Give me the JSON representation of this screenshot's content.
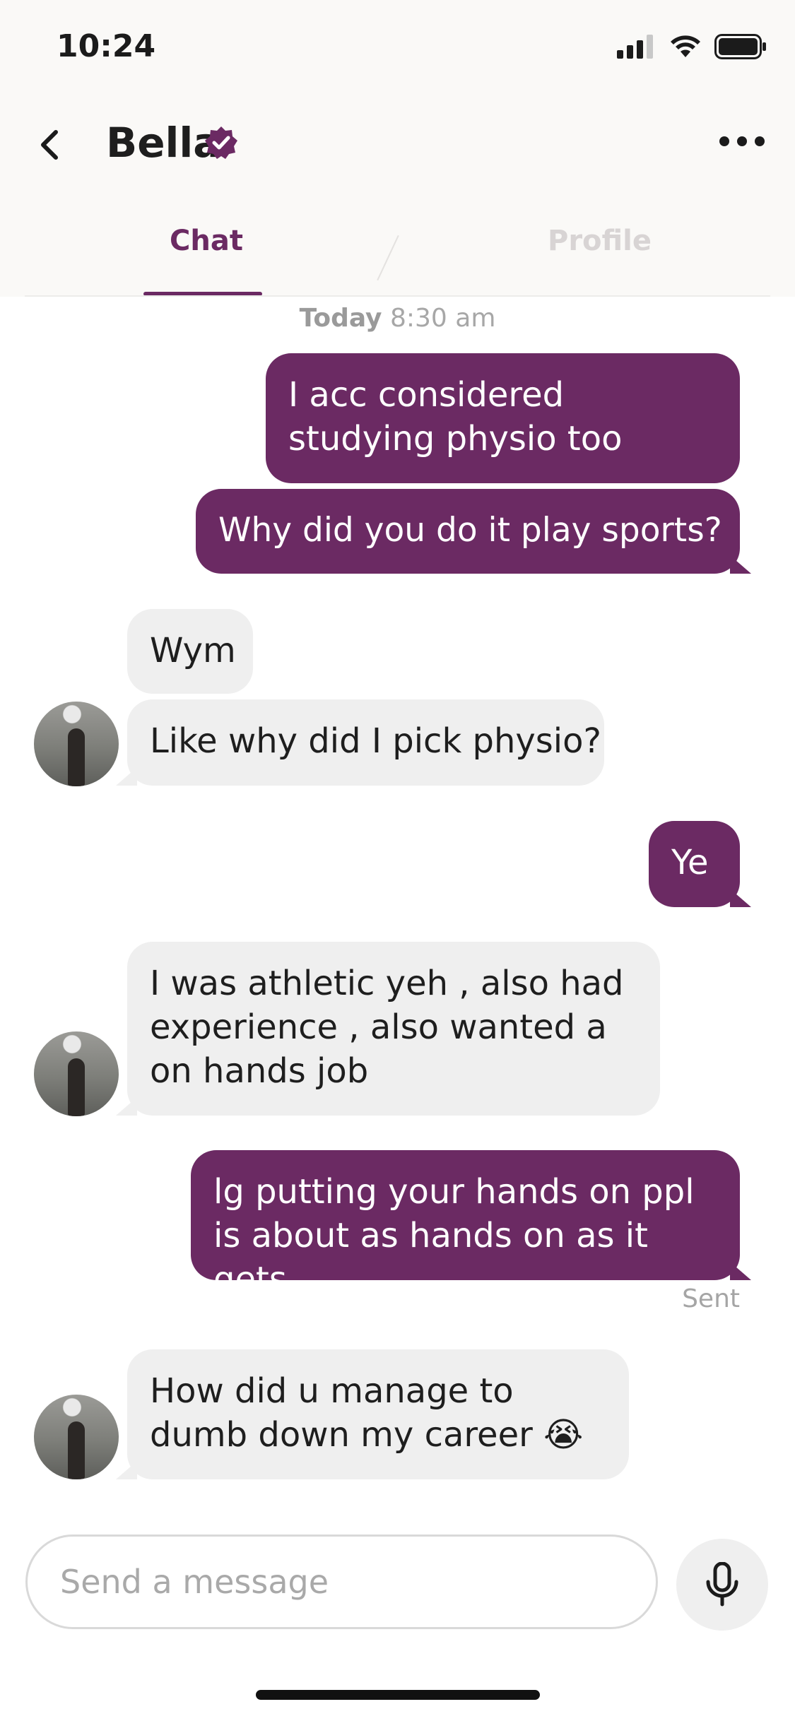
{
  "status_bar": {
    "time": "10:24"
  },
  "header": {
    "contact_name": "Bella"
  },
  "tabs": [
    {
      "label": "Chat",
      "active": true
    },
    {
      "label": "Profile",
      "active": false
    }
  ],
  "conversation": {
    "date_day": "Today",
    "date_time": "8:30 am",
    "messages": [
      {
        "from": "me",
        "text": "I acc considered studying physio too"
      },
      {
        "from": "me",
        "text": "Why did you do it play sports?"
      },
      {
        "from": "Bella",
        "text": "Wym"
      },
      {
        "from": "Bella",
        "text": "Like why did I pick physio?"
      },
      {
        "from": "me",
        "text": "Ye"
      },
      {
        "from": "Bella",
        "text": "I was athletic yeh , also had experience , also wanted a on hands job"
      },
      {
        "from": "me",
        "text": "lg putting your hands on ppl is about as hands on as it gets"
      },
      {
        "from": "Bella",
        "text": "How did u manage to dumb down my career 😭"
      }
    ],
    "sent_status": "Sent"
  },
  "composer": {
    "placeholder": "Send a message"
  },
  "colors": {
    "accent": "#6b2a63",
    "incoming_bubble": "#efefef"
  }
}
